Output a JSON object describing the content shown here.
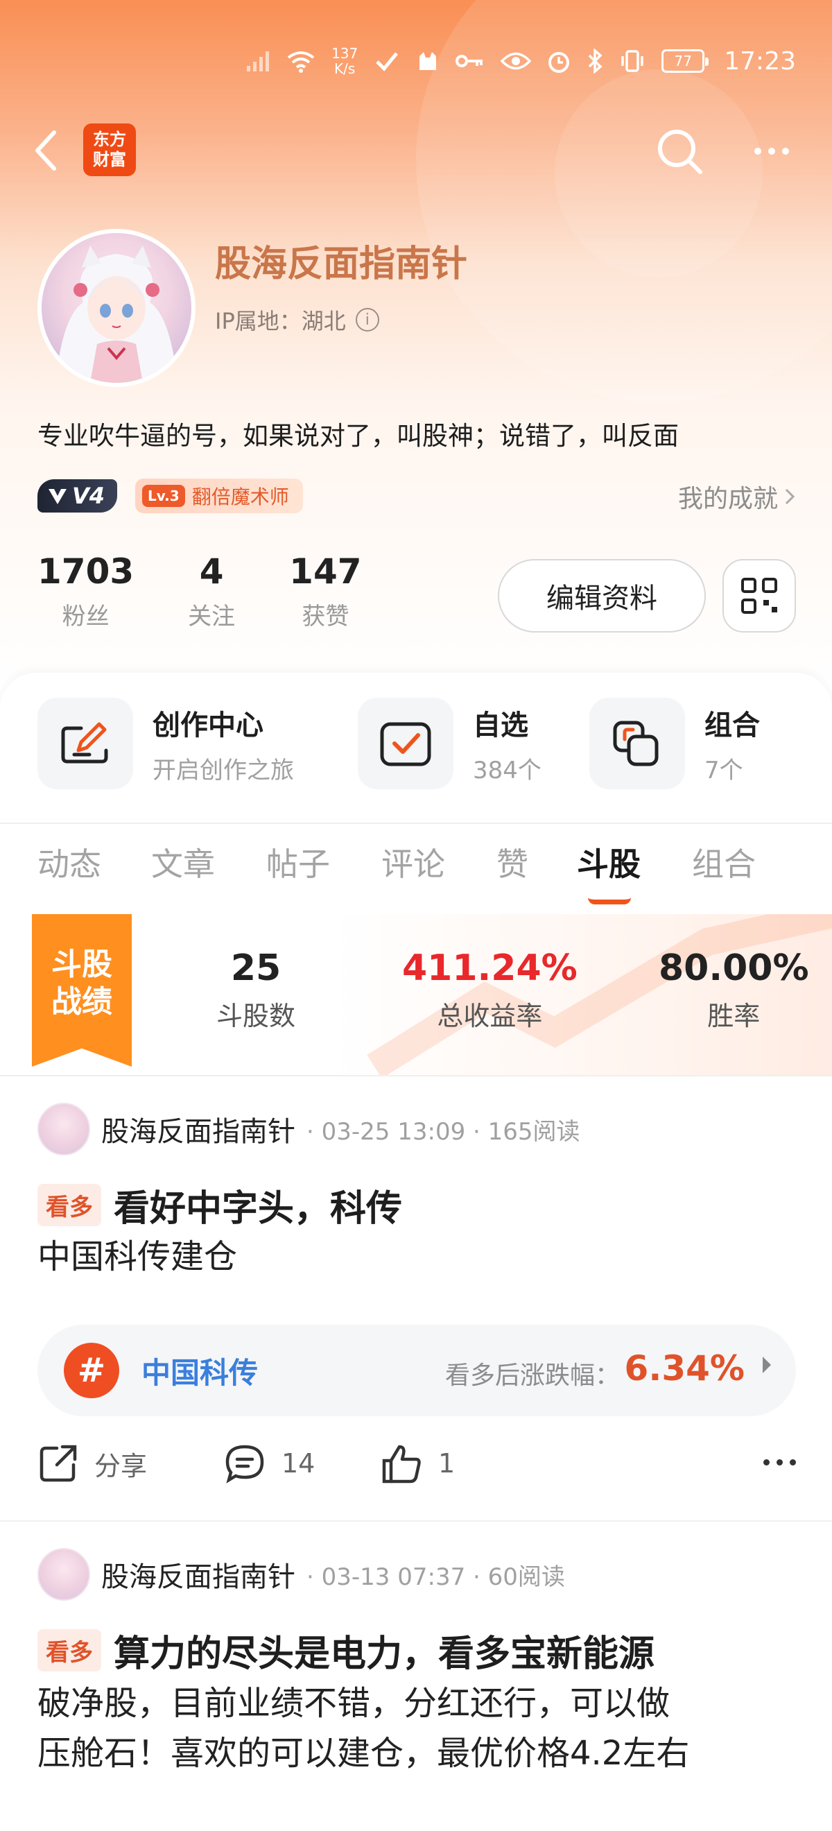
{
  "status_bar": {
    "net_speed_value": "137",
    "net_speed_unit": "K/s",
    "battery": "77",
    "time": "17:23"
  },
  "header": {
    "logo_line1": "东方",
    "logo_line2": "财富"
  },
  "profile": {
    "name": "股海反面指南针",
    "ip_label": "IP属地：湖北",
    "bio": "专业吹牛逼的号，如果说对了，叫股神；说错了，叫反面",
    "vip_badge": "V4",
    "level_chip": "Lv.3",
    "title_badge": "翻倍魔术师",
    "achievements_link": "我的成就",
    "stats": [
      {
        "value": "1703",
        "label": "粉丝"
      },
      {
        "value": "4",
        "label": "关注"
      },
      {
        "value": "147",
        "label": "获赞"
      }
    ],
    "edit_button": "编辑资料"
  },
  "shortcuts": [
    {
      "title": "创作中心",
      "subtitle": "开启创作之旅",
      "icon": "pen-icon"
    },
    {
      "title": "自选",
      "subtitle": "384个",
      "icon": "checkmark-icon"
    },
    {
      "title": "组合",
      "subtitle": "7个",
      "icon": "portfolio-icon"
    }
  ],
  "tabs": [
    {
      "label": "动态"
    },
    {
      "label": "文章"
    },
    {
      "label": "帖子"
    },
    {
      "label": "评论"
    },
    {
      "label": "赞"
    },
    {
      "label": "斗股",
      "active": true
    },
    {
      "label": "组合"
    }
  ],
  "battle": {
    "flag_line1": "斗股",
    "flag_line2": "战绩",
    "stats": [
      {
        "value": "25",
        "label": "斗股数"
      },
      {
        "value": "411.24%",
        "label": "总收益率"
      },
      {
        "value": "80.00%",
        "label": "胜率"
      }
    ]
  },
  "posts": [
    {
      "author": "股海反面指南针",
      "meta": "· 03-25 13:09 · 165阅读",
      "tag": "看多",
      "title": "看好中字头，科传",
      "body": "中国科传建仓",
      "stock": {
        "name": "中国科传",
        "change_label": "看多后涨跌幅：",
        "change": "6.34%"
      },
      "share_label": "分享",
      "comments": "14",
      "likes": "1"
    },
    {
      "author": "股海反面指南针",
      "meta": "· 03-13 07:37 · 60阅读",
      "tag": "看多",
      "title": "算力的尽头是电力，看多宝新能源",
      "body_line1": "破净股，目前业绩不错，分红还行，可以做",
      "body_line2": "压舱石！喜欢的可以建仓，最优价格4.2左右"
    }
  ],
  "colors": {
    "brand_orange": "#f98f54",
    "accent_red": "#e8282b",
    "link_blue": "#3a7fdc",
    "tag_orange": "#e0532a"
  }
}
